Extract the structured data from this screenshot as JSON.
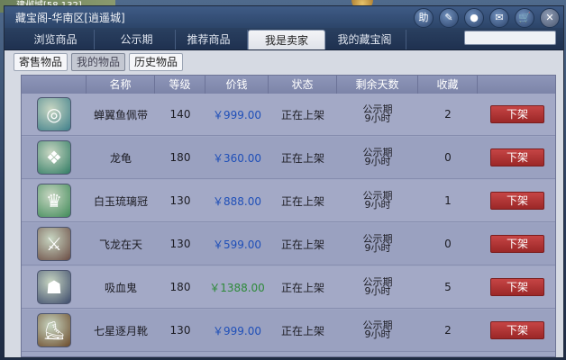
{
  "window": {
    "title": "藏宝阁-华南区[逍遥城]",
    "topleft_text": "建邺城[58,132]"
  },
  "title_icons": [
    {
      "name": "help-icon",
      "label": "助"
    },
    {
      "name": "pen-icon",
      "label": "✎"
    },
    {
      "name": "record-icon",
      "label": "●"
    },
    {
      "name": "chat-icon",
      "label": "✉"
    },
    {
      "name": "cart-icon",
      "label": "🛒"
    },
    {
      "name": "close-icon",
      "label": "✕"
    }
  ],
  "tabs": [
    "浏览商品",
    "公示期",
    "推荐商品",
    "我是卖家",
    "我的藏宝阁"
  ],
  "active_tab": "我是卖家",
  "search": {
    "value": ""
  },
  "subtabs": [
    "寄售物品",
    "我的物品",
    "历史物品"
  ],
  "active_subtab": "我的物品",
  "columns": [
    "名称",
    "等级",
    "价钱",
    "状态",
    "剩余天数",
    "收藏"
  ],
  "rows": [
    {
      "name": "蝉翼鱼佩带",
      "level": "140",
      "price": "￥999.00",
      "status": "正在上架",
      "days1": "公示期",
      "days2": "9小时",
      "fav": "2",
      "icon": "belt-icon",
      "color": "#3e7f8a"
    },
    {
      "name": "龙龟",
      "level": "180",
      "price": "￥360.00",
      "status": "正在上架",
      "days1": "公示期",
      "days2": "9小时",
      "fav": "0",
      "icon": "dragon-turtle-icon",
      "color": "#2f7b63"
    },
    {
      "name": "白玉琉璃冠",
      "level": "130",
      "price": "￥888.00",
      "status": "正在上架",
      "days1": "公示期",
      "days2": "9小时",
      "fav": "1",
      "icon": "crown-icon",
      "color": "#3f8a58"
    },
    {
      "name": "飞龙在天",
      "level": "130",
      "price": "￥599.00",
      "status": "正在上架",
      "days1": "公示期",
      "days2": "9小时",
      "fav": "0",
      "icon": "sword-icon",
      "color": "#6a4b43"
    },
    {
      "name": "吸血鬼",
      "level": "180",
      "price": "￥1388.00",
      "status": "正在上架",
      "days1": "公示期",
      "days2": "9小时",
      "fav": "5",
      "icon": "vampire-icon",
      "color": "#3c4a6b",
      "green": true
    },
    {
      "name": "七星逐月靴",
      "level": "130",
      "price": "￥999.00",
      "status": "正在上架",
      "days1": "公示期",
      "days2": "9小时",
      "fav": "2",
      "icon": "boots-icon",
      "color": "#6b4a2a"
    }
  ],
  "action_label": "下架"
}
